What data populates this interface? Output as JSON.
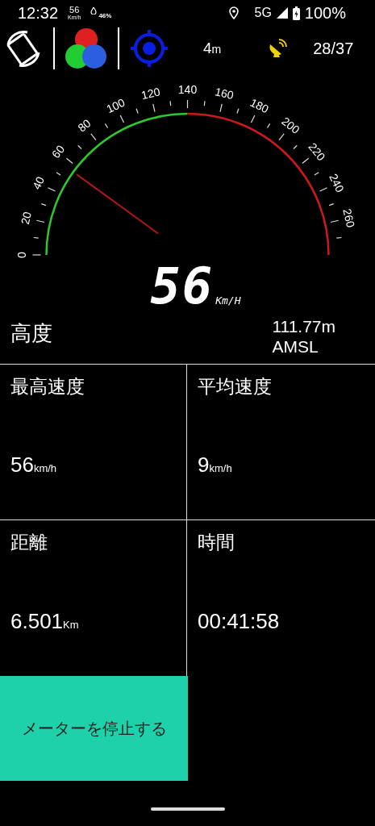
{
  "status_bar": {
    "time": "12:32",
    "speed": "56",
    "speed_unit": "Km/h",
    "battery_saver": "46%",
    "network": "5G",
    "battery": "100%"
  },
  "toolbar": {
    "accuracy": "4",
    "accuracy_unit": "m",
    "satellites": "28/37"
  },
  "gauge": {
    "tick_labels": [
      "0",
      "20",
      "40",
      "60",
      "80",
      "100",
      "120",
      "140",
      "160",
      "180",
      "200",
      "220",
      "240",
      "260"
    ]
  },
  "speed": {
    "value": "56",
    "unit": "Km/H"
  },
  "altitude": {
    "label": "高度",
    "value": "111.77m",
    "reference": "AMSL"
  },
  "stats": [
    {
      "label": "最高速度",
      "value": "56",
      "unit": "km/h"
    },
    {
      "label": "平均速度",
      "value": "9",
      "unit": "km/h"
    },
    {
      "label": "距離",
      "value": "6.501",
      "unit": "Km"
    },
    {
      "label": "時間",
      "value": "00:41:58"
    }
  ],
  "stop_button": {
    "label": "メーターを停止する"
  }
}
